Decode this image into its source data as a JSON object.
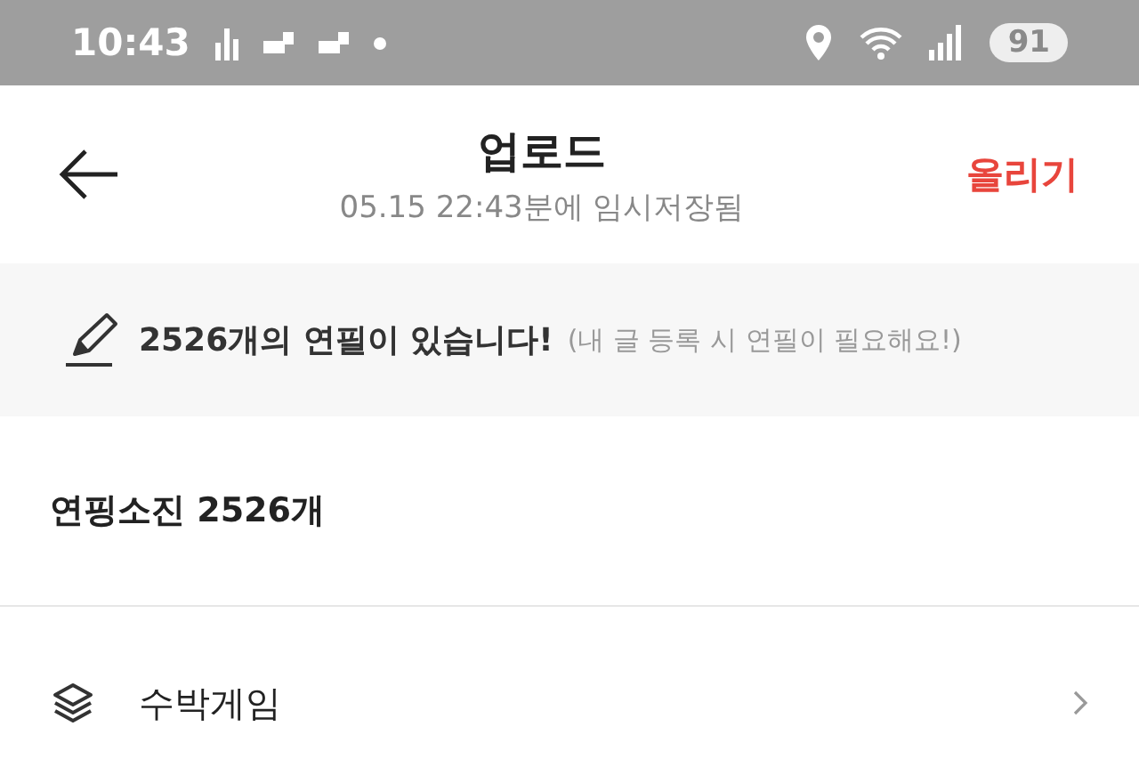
{
  "status_bar": {
    "time": "10:43",
    "battery": "91"
  },
  "header": {
    "title": "업로드",
    "subtitle": "05.15 22:43분에 임시저장됨",
    "action": "올리기"
  },
  "notice": {
    "text": "2526개의 연필이 있습니다!",
    "hint": "(내 글 등록 시 연필이 필요해요!)"
  },
  "section": {
    "title": "연핑소진 2526개"
  },
  "rows": [
    {
      "label": "수박게임"
    }
  ]
}
